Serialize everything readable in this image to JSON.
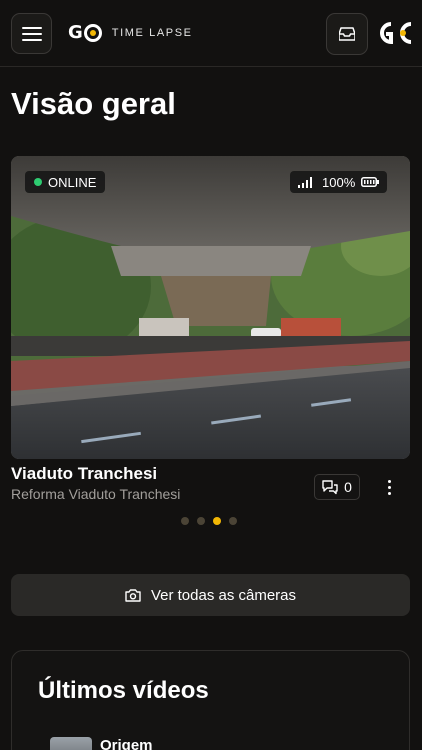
{
  "header": {
    "logo_main": "GO",
    "logo_sub": "TIME LAPSE",
    "user_logo_text": "GC",
    "accent_color": "#f2b705"
  },
  "page": {
    "title": "Visão geral"
  },
  "camera": {
    "status": "ONLINE",
    "status_color": "#2ecc71",
    "battery": "100%",
    "name": "Viaduto Tranchesi",
    "project": "Reforma Viaduto Tranchesi",
    "comments_count": "0",
    "icons": [
      "signal-icon",
      "battery-icon",
      "comment-icon",
      "more-vertical-icon"
    ]
  },
  "carousel": {
    "total": 4,
    "active_index": 2
  },
  "actions": {
    "view_all_cameras": "Ver todas as câmeras"
  },
  "videos": {
    "title": "Últimos vídeos",
    "items": [
      {
        "name": "Origem"
      }
    ]
  }
}
